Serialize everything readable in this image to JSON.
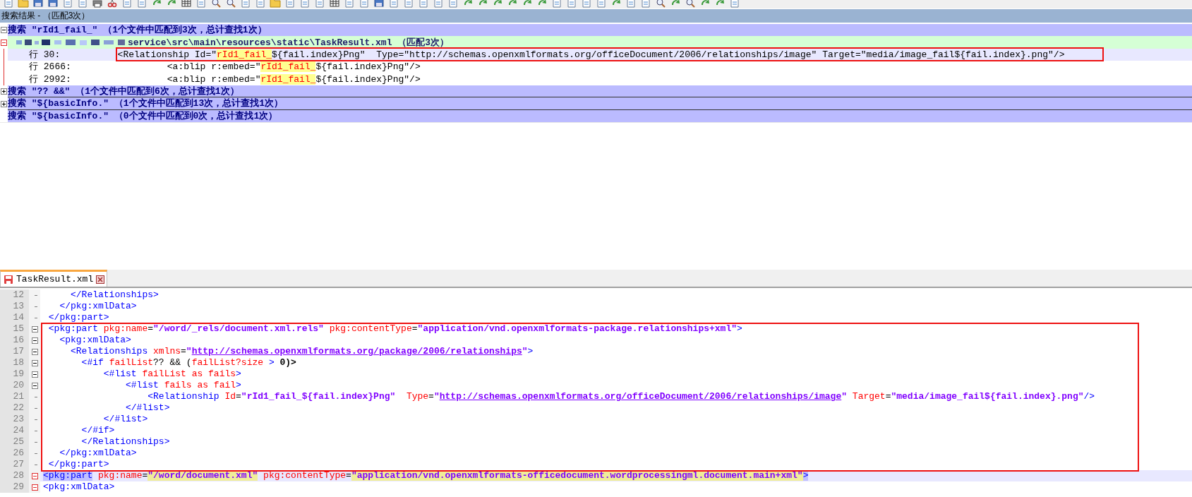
{
  "search_panel": {
    "title": "搜索结果 - （匹配3次）",
    "searches": [
      {
        "header": "搜索 \"rId1_fail_\" （1个文件中匹配到3次，总计查找1次）",
        "kind": "foldable",
        "expanded": true,
        "files": [
          {
            "path": "service\\src\\main\\resources\\static\\TaskResult.xml （匹配3次）",
            "expanded": true,
            "hits": [
              {
                "line": "行 30:",
                "selected": true,
                "code": [
                  {
                    "text": "  <Relationship Id=\"",
                    "kind": "plain"
                  },
                  {
                    "text": "rId1_fail_",
                    "kind": "match"
                  },
                  {
                    "text": "${fail.index}Png\"  Type=\"http://schemas.openxmlformats.org/officeDocument/2006/relationships/image\" Target=\"media/image_fail${fail.index}.png\"/>",
                    "kind": "plain"
                  }
                ]
              },
              {
                "line": "行 2666:",
                "selected": false,
                "code": [
                  {
                    "text": "           <a:blip r:embed=\"",
                    "kind": "plain"
                  },
                  {
                    "text": "rId1_fail_",
                    "kind": "match"
                  },
                  {
                    "text": "${fail.index}Png\"/>",
                    "kind": "plain"
                  }
                ]
              },
              {
                "line": "行 2992:",
                "selected": false,
                "code": [
                  {
                    "text": "           <a:blip r:embed=\"",
                    "kind": "plain"
                  },
                  {
                    "text": "rId1_fail_",
                    "kind": "match"
                  },
                  {
                    "text": "${fail.index}Png\"/>",
                    "kind": "plain"
                  }
                ]
              }
            ]
          }
        ]
      },
      {
        "header": "搜索 \"?? &&\" （1个文件中匹配到6次，总计查找1次）",
        "kind": "foldable",
        "expanded": false
      },
      {
        "header": "搜索 \"${basicInfo.\" （1个文件中匹配到13次，总计查找1次）",
        "kind": "foldable",
        "expanded": false
      },
      {
        "header": "搜索 \"${basicInfo.\" （0个文件中匹配到0次，总计查找1次）",
        "kind": "empty"
      }
    ]
  },
  "editor": {
    "tab": {
      "label": "TaskResult.xml",
      "selected": true
    },
    "lines": [
      {
        "num": "12",
        "kind": "line",
        "current": false,
        "tokens": [
          {
            "text": "     </Relationships>",
            "kind": "tag"
          }
        ]
      },
      {
        "num": "13",
        "kind": "line",
        "current": false,
        "tokens": [
          {
            "text": "   </pkg:xmlData>",
            "kind": "tag"
          }
        ]
      },
      {
        "num": "14",
        "kind": "line",
        "current": false,
        "tokens": [
          {
            "text": " </pkg:part>",
            "kind": "tag"
          }
        ]
      },
      {
        "num": "15",
        "kind": "open",
        "current": false,
        "tokens": [
          {
            "text": " <pkg:part",
            "kind": "tag"
          },
          {
            "text": " pkg:name",
            "kind": "attr"
          },
          {
            "text": "=",
            "kind": "plain"
          },
          {
            "text": "\"/word/_rels/document.xml.rels\"",
            "kind": "value"
          },
          {
            "text": " pkg:contentType",
            "kind": "attr"
          },
          {
            "text": "=",
            "kind": "plain"
          },
          {
            "text": "\"application/vnd.openxmlformats-package.relationships+xml\"",
            "kind": "value"
          },
          {
            "text": ">",
            "kind": "tag"
          }
        ]
      },
      {
        "num": "16",
        "kind": "open",
        "current": false,
        "tokens": [
          {
            "text": "   <pkg:xmlData>",
            "kind": "tag"
          }
        ]
      },
      {
        "num": "17",
        "kind": "open",
        "current": false,
        "tokens": [
          {
            "text": "     <Relationships",
            "kind": "tag"
          },
          {
            "text": " xmlns",
            "kind": "attr"
          },
          {
            "text": "=",
            "kind": "plain"
          },
          {
            "text": "\"",
            "kind": "value"
          },
          {
            "text": "http://schemas.openxmlformats.org/package/2006/relationships",
            "kind": "link"
          },
          {
            "text": "\"",
            "kind": "value"
          },
          {
            "text": ">",
            "kind": "tag"
          }
        ]
      },
      {
        "num": "18",
        "kind": "open",
        "current": false,
        "tokens": [
          {
            "text": "       <#if",
            "kind": "tag"
          },
          {
            "text": " failList",
            "kind": "attr"
          },
          {
            "text": "?? && (",
            "kind": "plain"
          },
          {
            "text": "failList?size",
            "kind": "attr"
          },
          {
            "text": " > ",
            "kind": "tag"
          },
          {
            "text": "0)>",
            "kind": "bold"
          }
        ]
      },
      {
        "num": "19",
        "kind": "open",
        "current": false,
        "tokens": [
          {
            "text": "           <#list",
            "kind": "tag"
          },
          {
            "text": " failList as fails",
            "kind": "attr"
          },
          {
            "text": ">",
            "kind": "tag"
          }
        ]
      },
      {
        "num": "20",
        "kind": "open",
        "current": false,
        "tokens": [
          {
            "text": "               <#list",
            "kind": "tag"
          },
          {
            "text": " fails as fail",
            "kind": "attr"
          },
          {
            "text": ">",
            "kind": "tag"
          }
        ]
      },
      {
        "num": "21",
        "kind": "line",
        "current": false,
        "tokens": [
          {
            "text": "                   <Relationship",
            "kind": "tag"
          },
          {
            "text": " Id",
            "kind": "attr"
          },
          {
            "text": "=",
            "kind": "plain"
          },
          {
            "text": "\"rId1_fail_${fail.index}Png\"",
            "kind": "value"
          },
          {
            "text": "  Type",
            "kind": "attr"
          },
          {
            "text": "=",
            "kind": "plain"
          },
          {
            "text": "\"",
            "kind": "value"
          },
          {
            "text": "http://schemas.openxmlformats.org/officeDocument/2006/relationships/image",
            "kind": "link"
          },
          {
            "text": "\"",
            "kind": "value"
          },
          {
            "text": " Target",
            "kind": "attr"
          },
          {
            "text": "=",
            "kind": "plain"
          },
          {
            "text": "\"media/image_fail${fail.index}.png\"",
            "kind": "value"
          },
          {
            "text": "/>",
            "kind": "tag"
          }
        ]
      },
      {
        "num": "22",
        "kind": "line",
        "current": false,
        "tokens": [
          {
            "text": "               </#list>",
            "kind": "tag"
          }
        ]
      },
      {
        "num": "23",
        "kind": "line",
        "current": false,
        "tokens": [
          {
            "text": "           </#list>",
            "kind": "tag"
          }
        ]
      },
      {
        "num": "24",
        "kind": "line",
        "current": false,
        "tokens": [
          {
            "text": "       </#if>",
            "kind": "tag"
          }
        ]
      },
      {
        "num": "25",
        "kind": "line",
        "current": false,
        "tokens": [
          {
            "text": "       </Relationships>",
            "kind": "tag"
          }
        ]
      },
      {
        "num": "26",
        "kind": "line",
        "current": false,
        "tokens": [
          {
            "text": "   </pkg:xmlData>",
            "kind": "tag"
          }
        ]
      },
      {
        "num": "27",
        "kind": "line",
        "current": false,
        "tokens": [
          {
            "text": " </pkg:part>",
            "kind": "tag"
          }
        ]
      },
      {
        "num": "28",
        "kind": "marked",
        "current": true,
        "tokens": [
          {
            "text": "<pkg:part",
            "kind": "selection"
          },
          {
            "text": " pkg:name",
            "kind": "attr"
          },
          {
            "text": "=",
            "kind": "plain"
          },
          {
            "text": "\"/word/document.xml\"",
            "kind": "found"
          },
          {
            "text": " pkg:contentType",
            "kind": "attr"
          },
          {
            "text": "=",
            "kind": "plain"
          },
          {
            "text": "\"application/vnd.openxmlformats-officedocument.wordprocessingml.document.main+xml\"",
            "kind": "found"
          },
          {
            "text": ">",
            "kind": "selection"
          }
        ]
      },
      {
        "num": "29",
        "kind": "marked",
        "current": false,
        "tokens": [
          {
            "text": "<pkg:xmlData>",
            "kind": "tag"
          }
        ]
      }
    ]
  }
}
